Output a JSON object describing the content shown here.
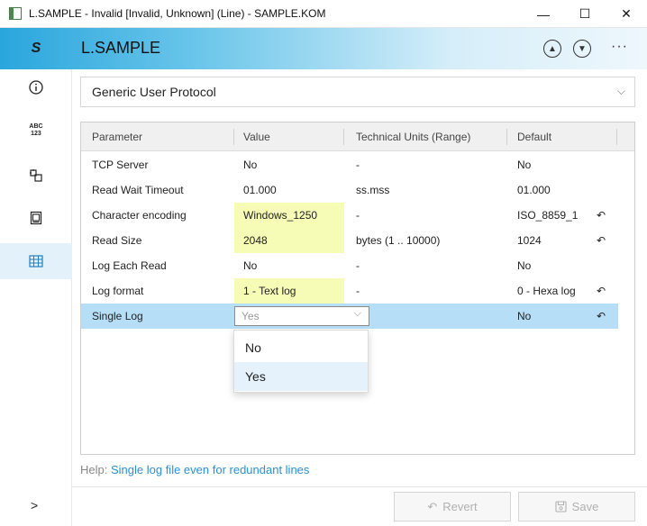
{
  "window": {
    "title": "L.SAMPLE - Invalid [Invalid, Unknown] (Line) - SAMPLE.KOM",
    "min_glyph": "—",
    "max_glyph": "☐",
    "close_glyph": "✕"
  },
  "header": {
    "logo_glyph": "S",
    "title": "L.SAMPLE",
    "up_glyph": "▲",
    "down_glyph": "▼",
    "more_glyph": "···"
  },
  "rail": {
    "info_icon": "info-icon",
    "abc_top": "ABC",
    "abc_bottom": "123",
    "expand_glyph": ">"
  },
  "protocol": {
    "label": "Generic User Protocol",
    "chevron": "⌵"
  },
  "grid": {
    "columns": {
      "parameter": "Parameter",
      "value": "Value",
      "units": "Technical Units (Range)",
      "default": "Default"
    },
    "rows": [
      {
        "parameter": "TCP Server",
        "value": "No",
        "units": "-",
        "default": "No"
      },
      {
        "parameter": "Read Wait Timeout",
        "value": "01.000",
        "units": "ss.mss",
        "default": "01.000"
      },
      {
        "parameter": "Character encoding",
        "value": "Windows_1250",
        "units": "-",
        "default": "ISO_8859_1"
      },
      {
        "parameter": "Read Size",
        "value": "2048",
        "units": "bytes (1 .. 10000)",
        "default": "1024"
      },
      {
        "parameter": "Log Each Read",
        "value": "No",
        "units": "-",
        "default": "No"
      },
      {
        "parameter": "Log format",
        "value": "1 - Text log",
        "units": "-",
        "default": "0 - Hexa log"
      },
      {
        "parameter": "Single Log",
        "value": "Yes",
        "units": "",
        "default": "No"
      }
    ],
    "dropdown_options": [
      "No",
      "Yes"
    ],
    "reset_glyph": "↶"
  },
  "help": {
    "prefix": "Help:",
    "text": "Single log file even for redundant lines"
  },
  "footer": {
    "revert_label": "Revert",
    "save_label": "Save",
    "revert_glyph": "↶",
    "save_glyph": "💾"
  },
  "colors": {
    "accent": "#2aa6dd",
    "modified_value_bg": "#f6fbb6",
    "selected_row_bg": "#b6dff7",
    "help_link": "#2b90d0"
  }
}
